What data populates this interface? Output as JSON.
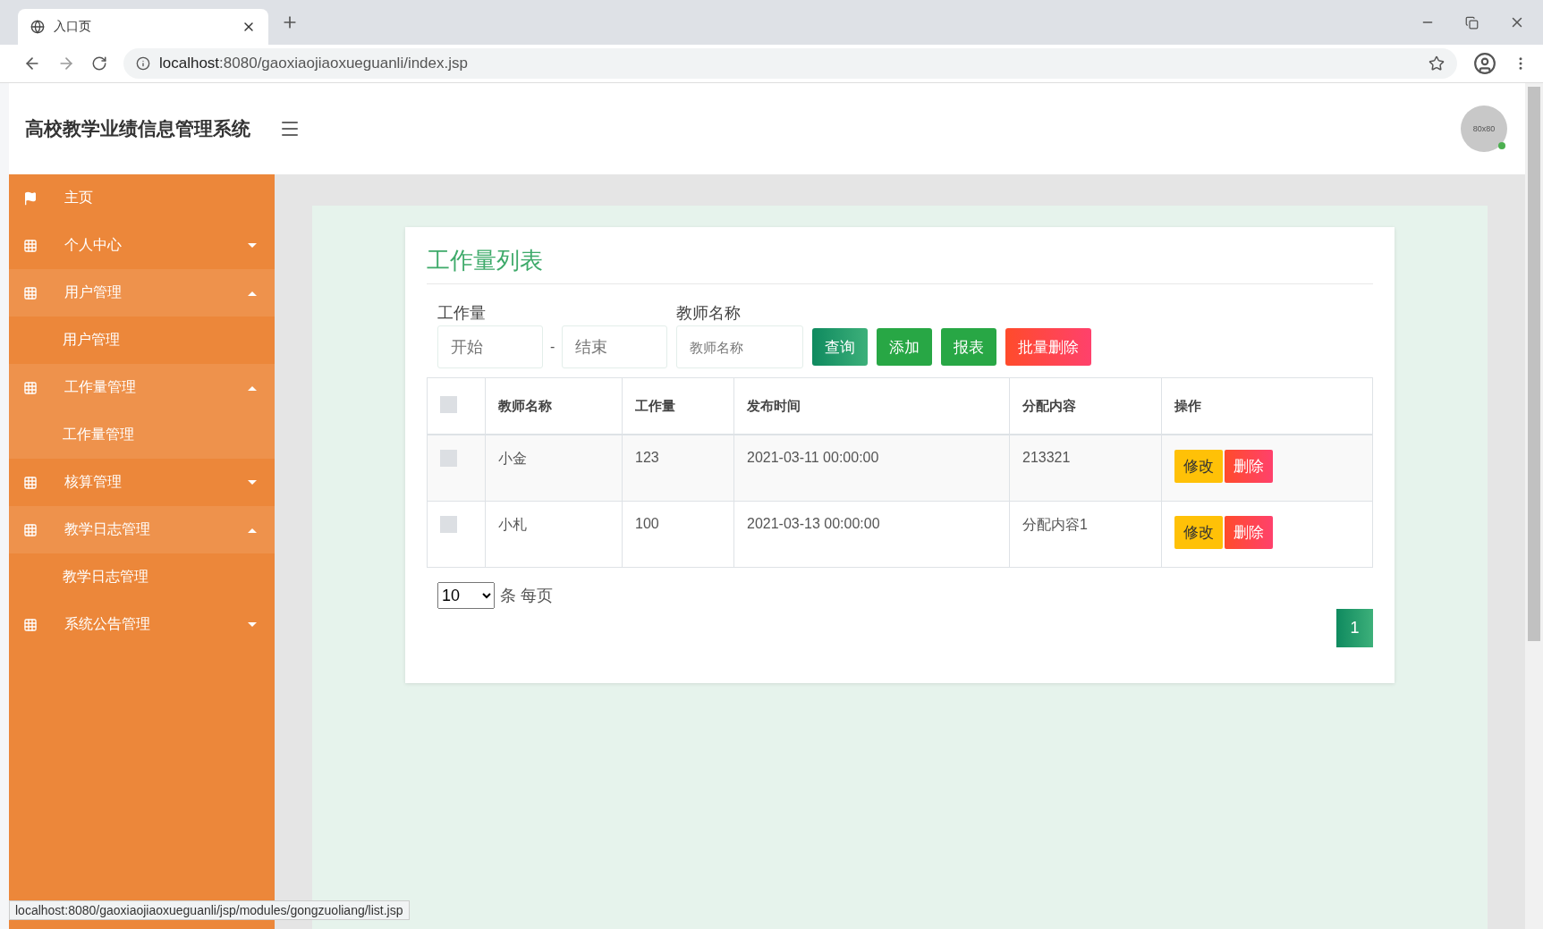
{
  "browser": {
    "tab_title": "入口页",
    "url_host": "localhost",
    "url_rest": ":8080/gaoxiaojiaoxueguanli/index.jsp",
    "status_url": "localhost:8080/gaoxiaojiaoxueguanli/jsp/modules/gongzuoliang/list.jsp"
  },
  "header": {
    "title": "高校教学业绩信息管理系统",
    "avatar": "80x80"
  },
  "sidebar": {
    "items": [
      {
        "label": "主页",
        "kind": "home",
        "expanded": false
      },
      {
        "label": "个人中心",
        "kind": "group",
        "expanded": false
      },
      {
        "label": "用户管理",
        "kind": "group",
        "expanded": true,
        "children": [
          {
            "label": "用户管理",
            "selected": false
          }
        ]
      },
      {
        "label": "工作量管理",
        "kind": "group",
        "expanded": true,
        "children": [
          {
            "label": "工作量管理",
            "selected": true
          }
        ]
      },
      {
        "label": "核算管理",
        "kind": "group",
        "expanded": false
      },
      {
        "label": "教学日志管理",
        "kind": "group",
        "expanded": true,
        "children": [
          {
            "label": "教学日志管理",
            "selected": false
          }
        ]
      },
      {
        "label": "系统公告管理",
        "kind": "group",
        "expanded": false
      }
    ]
  },
  "card": {
    "title": "工作量列表",
    "filters": {
      "range_label": "工作量",
      "start_placeholder": "开始",
      "separator": "-",
      "end_placeholder": "结束",
      "name_label": "教师名称",
      "name_placeholder": "教师名称"
    },
    "buttons": [
      {
        "label": "查询",
        "kind": "search"
      },
      {
        "label": "添加",
        "kind": "add"
      },
      {
        "label": "报表",
        "kind": "report"
      },
      {
        "label": "批量删除",
        "kind": "danger"
      }
    ],
    "table": {
      "columns": [
        "教师名称",
        "工作量",
        "发布时间",
        "分配内容",
        "操作"
      ],
      "header_checked": false,
      "rows": [
        {
          "checked": false,
          "cells": [
            "小金",
            "123",
            "2021-03-11 00:00:00",
            "213321"
          ],
          "actions": [
            "修改",
            "删除"
          ]
        },
        {
          "checked": false,
          "cells": [
            "小札",
            "100",
            "2021-03-13 00:00:00",
            "分配内容1"
          ],
          "actions": [
            "修改",
            "删除"
          ]
        }
      ]
    },
    "page_size": {
      "value": "10",
      "suffix": "条 每页"
    },
    "pages": [
      {
        "label": "1",
        "selected": true
      }
    ]
  }
}
